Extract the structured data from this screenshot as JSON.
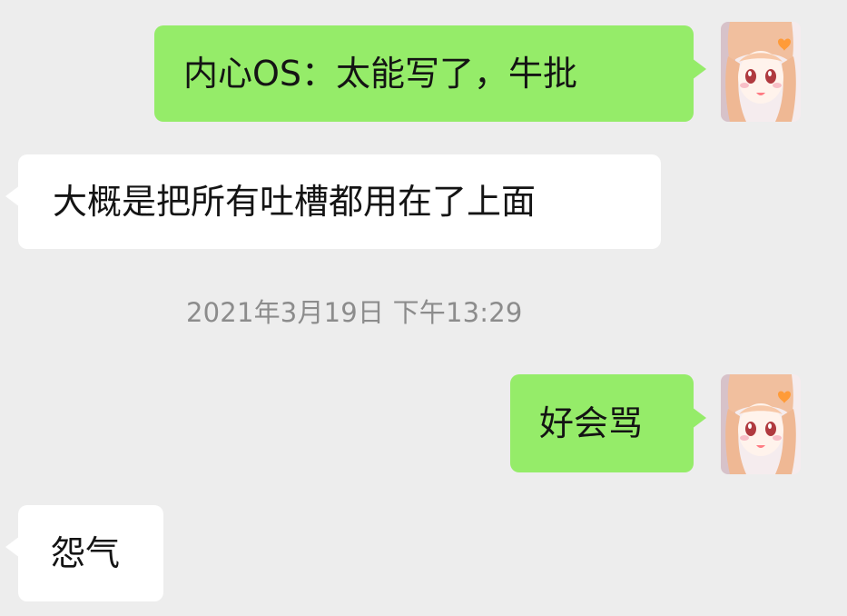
{
  "chat": {
    "messages": [
      {
        "sender": "me",
        "text": "内心OS：太能写了，牛批"
      },
      {
        "sender": "other",
        "text": "大概是把所有吐槽都用在了上面"
      },
      {
        "sender": "me",
        "text": "好会骂"
      },
      {
        "sender": "other",
        "text": "怨气"
      }
    ],
    "timestamp": "2021年3月19日 下午13:29"
  },
  "colors": {
    "background": "#ededed",
    "outgoing_bubble": "#95ec69",
    "incoming_bubble": "#ffffff",
    "timestamp_text": "#8c8c8c"
  },
  "icons": {
    "avatar": "anime-girl-avatar-icon"
  }
}
